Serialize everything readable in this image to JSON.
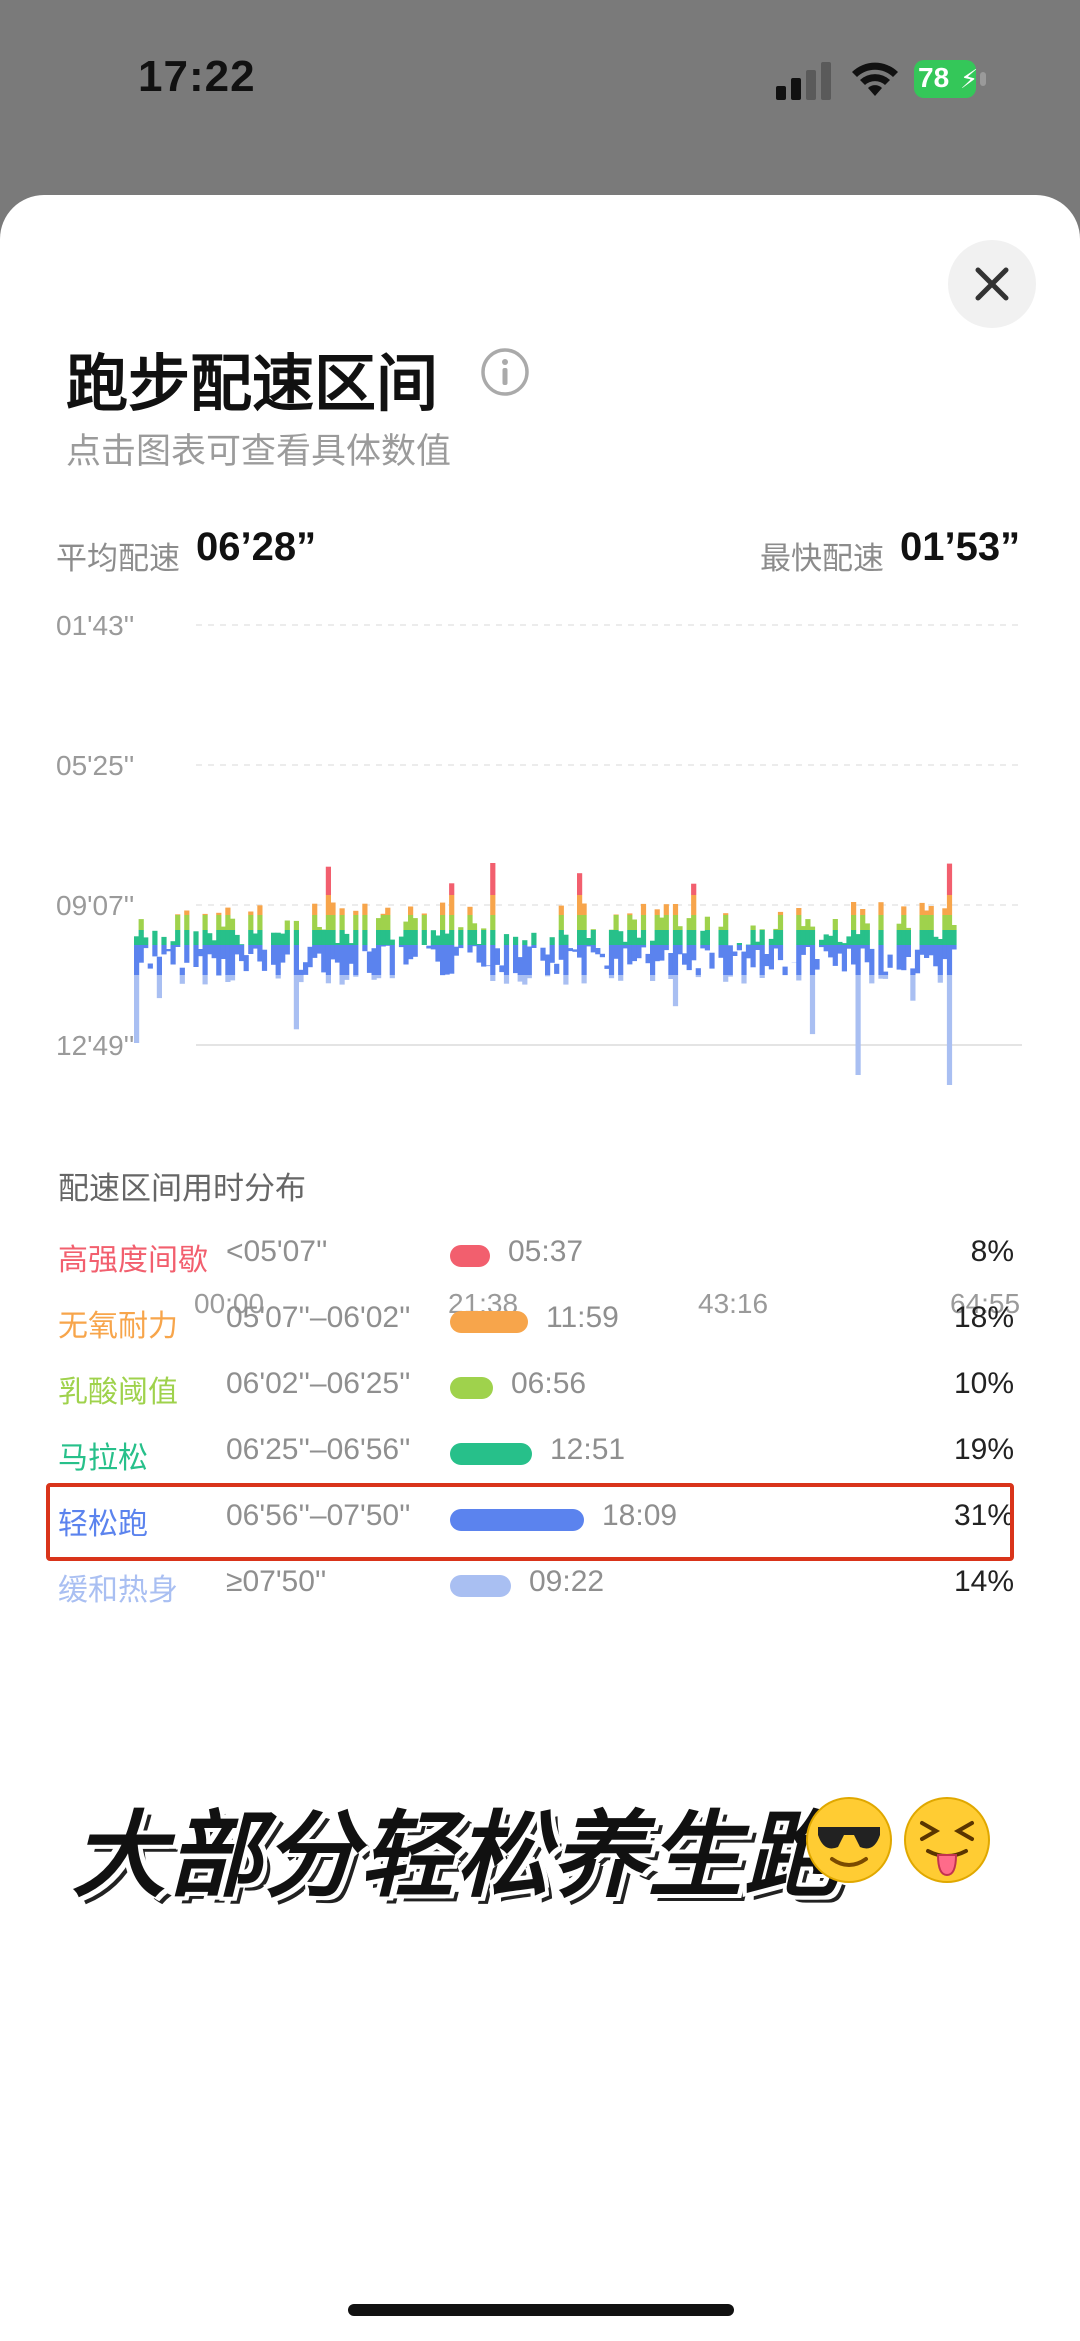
{
  "status": {
    "time": "17:22",
    "battery": "78"
  },
  "header": {
    "title": "跑步配速区间",
    "subtitle": "点击图表可查看具体数值"
  },
  "summary": {
    "avg_label": "平均配速",
    "avg_value": "06’28”",
    "fast_label": "最快配速",
    "fast_value": "01’53”"
  },
  "chart_data": {
    "type": "bar",
    "y_axis_reversed": true,
    "y_ticks": [
      "01'43''",
      "05'25''",
      "09'07''",
      "12'49''"
    ],
    "x_ticks": [
      "00:00",
      "21:38",
      "43:16",
      "64:55"
    ],
    "grid": true,
    "zone_colors": [
      "#f25f6e",
      "#f7a54b",
      "#9fd24c",
      "#27c08a",
      "#5b83ee",
      "#a9bff2"
    ]
  },
  "distribution": {
    "title": "配速区间用时分布",
    "zones": [
      {
        "name": "高强度间歇",
        "range": "<05'07''",
        "time": "05:37",
        "percent": "8%",
        "share": 0.08,
        "color": "#f25f6e"
      },
      {
        "name": "无氧耐力",
        "range": "05'07''–06'02''",
        "time": "11:59",
        "percent": "18%",
        "share": 0.18,
        "color": "#f7a54b"
      },
      {
        "name": "乳酸阈值",
        "range": "06'02''–06'25''",
        "time": "06:56",
        "percent": "10%",
        "share": 0.1,
        "color": "#9fd24c"
      },
      {
        "name": "马拉松",
        "range": "06'25''–06'56''",
        "time": "12:51",
        "percent": "19%",
        "share": 0.19,
        "color": "#27c08a"
      },
      {
        "name": "轻松跑",
        "range": "06'56''–07'50''",
        "time": "18:09",
        "percent": "31%",
        "share": 0.31,
        "color": "#5b83ee"
      },
      {
        "name": "缓和热身",
        "range": "≥07'50''",
        "time": "09:22",
        "percent": "14%",
        "share": 0.14,
        "color": "#a9bff2"
      }
    ]
  },
  "caption": "大部分轻松养生跑",
  "icons": {
    "close": "close-icon",
    "info": "info-icon",
    "emoji1": "sunglasses-emoji",
    "emoji2": "tongue-squint-emoji"
  }
}
